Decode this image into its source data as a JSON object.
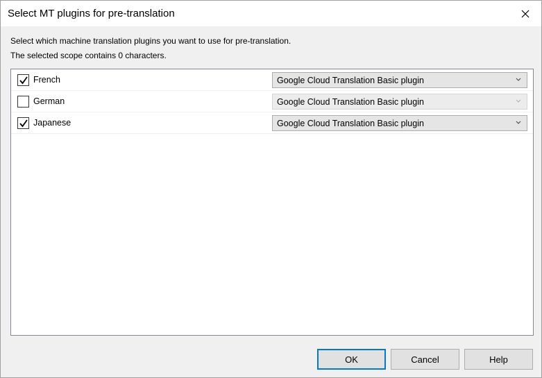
{
  "window": {
    "title": "Select MT plugins for pre-translation"
  },
  "description": {
    "line1": "Select which machine translation plugins you want to use for pre-translation.",
    "line2": "The selected scope contains 0 characters."
  },
  "languages": [
    {
      "name": "French",
      "checked": true,
      "plugin": "Google Cloud Translation Basic plugin",
      "enabled": true
    },
    {
      "name": "German",
      "checked": false,
      "plugin": "Google Cloud Translation Basic plugin",
      "enabled": false
    },
    {
      "name": "Japanese",
      "checked": true,
      "plugin": "Google Cloud Translation Basic plugin",
      "enabled": true
    }
  ],
  "buttons": {
    "ok": "OK",
    "cancel": "Cancel",
    "help": "Help"
  },
  "icons": {
    "close": "close-icon",
    "check": "checkmark-icon",
    "dropdown": "chevron-down-icon"
  },
  "colors": {
    "accent": "#0078d7",
    "dialog_bg": "#f0f0f0"
  }
}
